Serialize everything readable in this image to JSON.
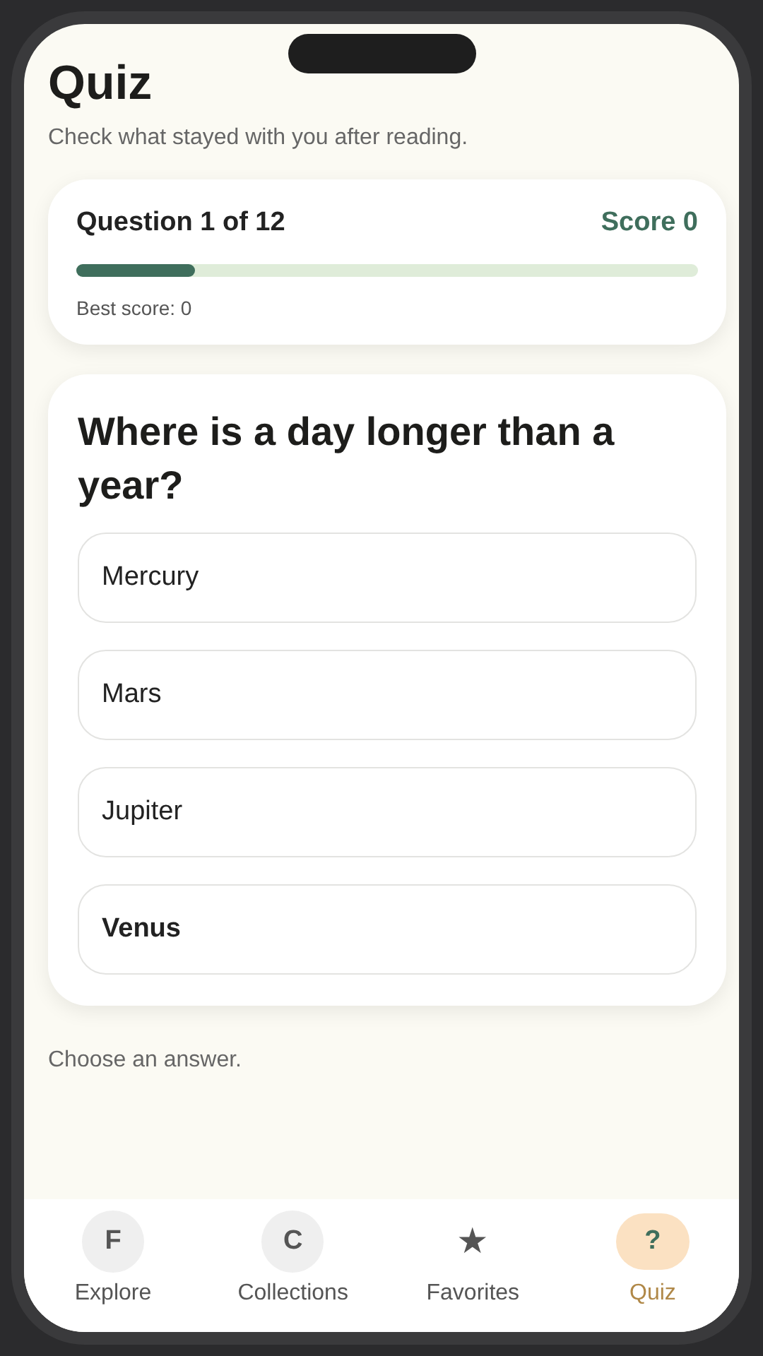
{
  "header": {
    "title": "Quiz",
    "subtitle": "Check what stayed with you after reading."
  },
  "progress_card": {
    "question_label": "Question 1 of 12",
    "score": "Score 0",
    "level": 0.19,
    "best_score": "Best score: 0"
  },
  "question_card": {
    "question": "Where is a day longer than a year?",
    "options": [
      {
        "label": "Mercury",
        "selected": false
      },
      {
        "label": "Mars",
        "selected": false
      },
      {
        "label": "Jupiter",
        "selected": false
      },
      {
        "label": "Venus",
        "selected": true
      }
    ]
  },
  "hint": "Choose an answer.",
  "tab_bar": [
    {
      "glyph": "F",
      "label": "Explore",
      "kind": "circle",
      "selected": false
    },
    {
      "glyph": "C",
      "label": "Collections",
      "kind": "circle",
      "selected": false
    },
    {
      "glyph": "★",
      "label": "Favorites",
      "kind": "plain",
      "selected": false
    },
    {
      "glyph": "?",
      "label": "Quiz",
      "kind": "circle",
      "selected": true
    }
  ]
}
